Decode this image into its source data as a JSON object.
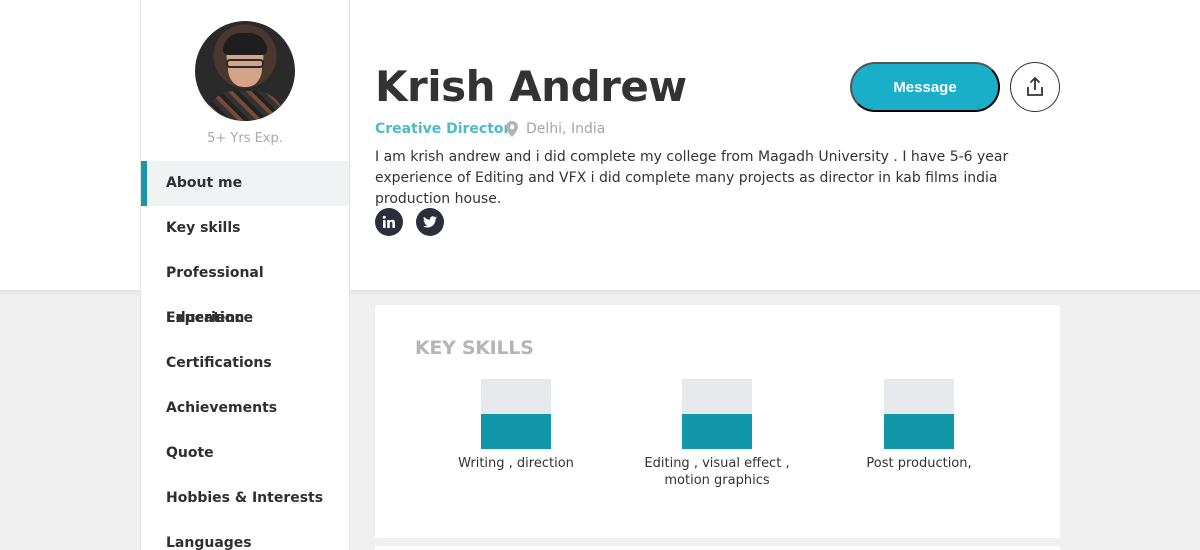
{
  "profile": {
    "name": "Krish Andrew",
    "role": "Creative Director",
    "location": "Delhi, India",
    "experience": "5+ Yrs Exp.",
    "bio": "I am krish andrew and i did complete my college from Magadh University . I have 5-6 year experience of Editing and VFX i did complete many projects as director in kab films india production house."
  },
  "actions": {
    "message_label": "Message",
    "share_icon": "share-icon"
  },
  "social": [
    {
      "icon": "linkedin-icon"
    },
    {
      "icon": "twitter-icon"
    }
  ],
  "sidebar": {
    "items": [
      {
        "label": "About me",
        "active": true
      },
      {
        "label": "Key skills"
      },
      {
        "label": "Professional Experience"
      },
      {
        "label": "Education"
      },
      {
        "label": "Certifications"
      },
      {
        "label": "Achievements"
      },
      {
        "label": "Quote"
      },
      {
        "label": "Hobbies & Interests"
      },
      {
        "label": "Languages"
      }
    ]
  },
  "key_skills": {
    "title": "KEY SKILLS",
    "items": [
      {
        "label": "Writing , direction",
        "level": 0.5
      },
      {
        "label": "Editing , visual effect , motion graphics",
        "level": 0.5
      },
      {
        "label": "Post production,",
        "level": 0.5
      }
    ]
  },
  "colors": {
    "accent": "#1aafc9",
    "skill_fill": "#1196aa",
    "role_text": "#4bbbc9"
  }
}
